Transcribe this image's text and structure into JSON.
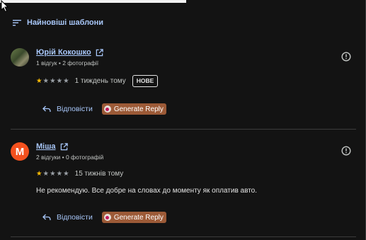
{
  "sort": {
    "label": "Найновіші шаблони",
    "icon": "sort-icon"
  },
  "reviews": [
    {
      "name": "Юрій Кокошко",
      "meta": "1 відгук • 2 фотографії",
      "rating": 1,
      "max_rating": 5,
      "time": "1 тиждень тому",
      "badge": "НОВЕ",
      "text": "",
      "reply_label": "Відповісти",
      "generate_label": "Generate Reply",
      "avatar_type": "photo"
    },
    {
      "name": "Міша",
      "avatar_letter": "M",
      "meta": "2 відгуки • 0 фотографій",
      "rating": 1,
      "max_rating": 5,
      "time": "15 тижнів тому",
      "badge": "",
      "text": "Не рекомендую. Все добре на словах до моменту як оплатив авто.",
      "reply_label": "Відповісти",
      "generate_label": "Generate Reply",
      "avatar_type": "letter"
    }
  ],
  "colors": {
    "background": "#131313",
    "link": "#a8c7fa",
    "star": "#fbbc04",
    "generate_button": "#9c5a37",
    "avatar_letter_bg": "#f4511e"
  }
}
